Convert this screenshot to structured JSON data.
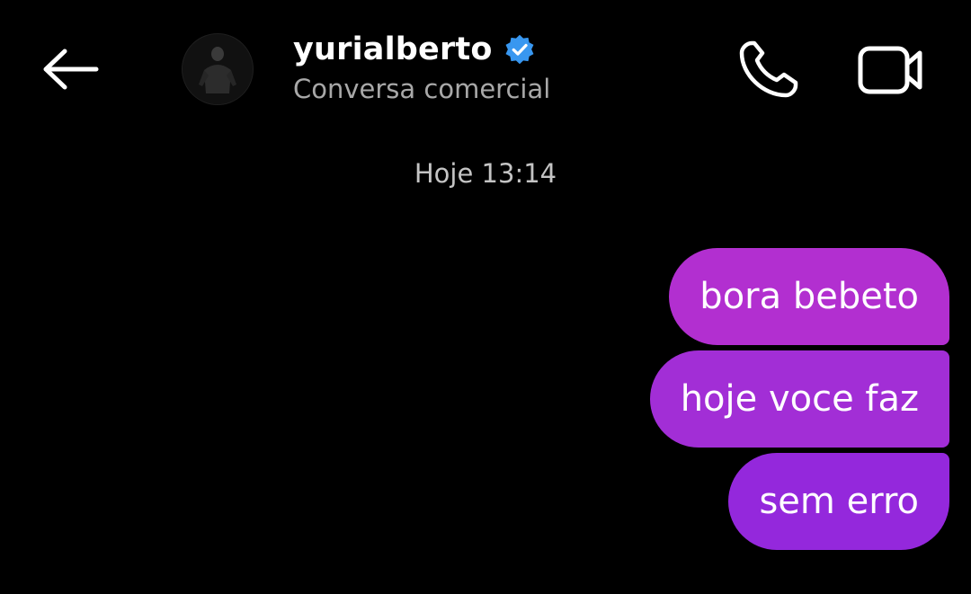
{
  "header": {
    "back_icon": "arrow-left-icon",
    "username": "yurialberto",
    "verified_icon": "verified-badge-icon",
    "subtitle": "Conversa comercial",
    "call_icon": "phone-icon",
    "video_icon": "video-camera-icon"
  },
  "conversation": {
    "timestamp": "Hoje 13:14",
    "messages": [
      {
        "text": "bora bebeto",
        "sender": "me"
      },
      {
        "text": "hoje voce faz",
        "sender": "me"
      },
      {
        "text": "sem erro",
        "sender": "me"
      }
    ]
  },
  "colors": {
    "background": "#000000",
    "verified_badge": "#3897f0",
    "bubble_top": "#b22fd0",
    "bubble_middle": "#a22ed6",
    "bubble_bottom": "#9428dc",
    "subtitle_text": "#a8a8a8"
  }
}
